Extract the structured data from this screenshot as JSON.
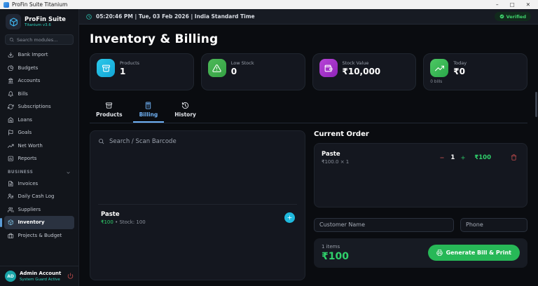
{
  "window": {
    "title": "ProFin Suite Titanium",
    "minimize": "–",
    "maximize": "□",
    "close": "✕"
  },
  "sidebar": {
    "brand": {
      "name": "ProFin Suite",
      "version": "Titanium v3.6"
    },
    "search": {
      "placeholder": "Search modules..."
    },
    "items": [
      {
        "label": "Bank Import"
      },
      {
        "label": "Budgets"
      },
      {
        "label": "Accounts"
      },
      {
        "label": "Bills"
      },
      {
        "label": "Subscriptions"
      },
      {
        "label": "Loans"
      },
      {
        "label": "Goals"
      },
      {
        "label": "Net Worth"
      },
      {
        "label": "Reports"
      }
    ],
    "business_section": {
      "label": "BUSINESS"
    },
    "business_items": [
      {
        "label": "Invoices"
      },
      {
        "label": "Daily Cash Log"
      },
      {
        "label": "Suppliers"
      },
      {
        "label": "Inventory"
      },
      {
        "label": "Projects & Budget"
      }
    ],
    "footer": {
      "initials": "AD",
      "name": "Admin Account",
      "status": "System Guard Active"
    }
  },
  "header": {
    "datetime": "05:20:46 PM | Tue, 03 Feb 2026 | India Standard Time",
    "verified": "Verified",
    "accent_color": "#2dd4bf",
    "verified_color": "#3fd06c"
  },
  "page": {
    "title": "Inventory & Billing"
  },
  "stats": [
    {
      "label": "Products",
      "value": "1",
      "color": "#1fb9dd"
    },
    {
      "label": "Low Stock",
      "value": "0",
      "color": "#43b14b"
    },
    {
      "label": "Stock Value",
      "value": "₹10,000",
      "color": "#a93fd1"
    },
    {
      "label": "Today",
      "value": "₹0",
      "sub": "0 bills",
      "color": "#3fc257"
    }
  ],
  "tabs": [
    {
      "label": "Products"
    },
    {
      "label": "Billing"
    },
    {
      "label": "History"
    }
  ],
  "billing": {
    "search_placeholder": "Search / Scan Barcode",
    "products": [
      {
        "name": "Paste",
        "price": "₹100",
        "separator": "•",
        "stock": "Stock: 100"
      }
    ],
    "order": {
      "title": "Current Order",
      "items": [
        {
          "name": "Paste",
          "detail": "₹100.0 × 1",
          "qty": "1",
          "amount": "₹100"
        }
      ],
      "customer_placeholder": "Customer Name",
      "phone_placeholder": "Phone",
      "items_count": "1 items",
      "total": "₹100",
      "total_color": "#2fd16b",
      "generate_label": "Generate Bill & Print",
      "generate_color": "#27b857"
    }
  }
}
